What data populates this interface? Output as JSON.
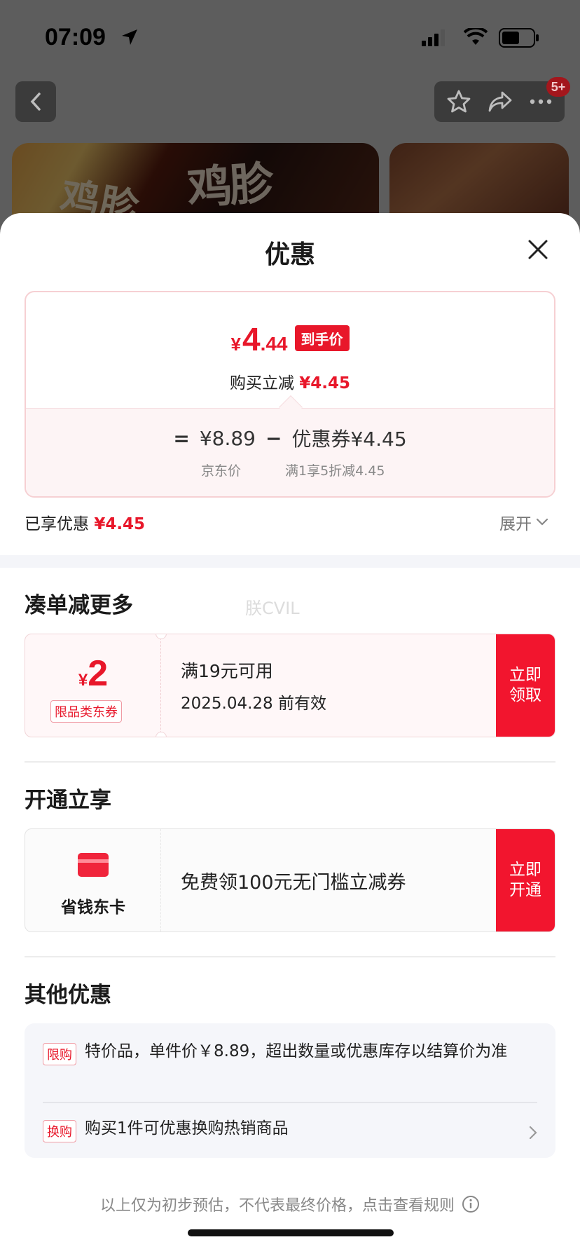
{
  "status_bar": {
    "time": "07:09"
  },
  "top_nav": {
    "badge": "5+"
  },
  "background": {
    "brand_text": "鸡胗"
  },
  "sheet": {
    "title": "优惠",
    "price_card": {
      "currency": "¥",
      "final_int": "4",
      "final_dec": ".44",
      "final_tag": "到手价",
      "instant_off_label": "购买立减",
      "instant_off_value": "¥4.45",
      "formula": {
        "equals": "=",
        "jd_price": "¥8.89",
        "jd_price_label": "京东价",
        "minus": "−",
        "coupon": "优惠券¥4.45",
        "coupon_desc": "满1享5折减4.45"
      }
    },
    "enjoyed": {
      "label": "已享优惠",
      "value": "¥4.45",
      "expand": "展开"
    },
    "watermark": "朕CVIL",
    "more_section": {
      "title": "凑单减更多",
      "coupon": {
        "currency": "¥",
        "amount": "2",
        "category": "限品类东券",
        "condition": "满19元可用",
        "validity": "2025.04.28 前有效",
        "cta_line1": "立即",
        "cta_line2": "领取"
      }
    },
    "membership_section": {
      "title": "开通立享",
      "card_name": "省钱东卡",
      "benefit": "免费领100元无门槛立减券",
      "cta_line1": "立即",
      "cta_line2": "开通"
    },
    "other_section": {
      "title": "其他优惠",
      "offers": [
        {
          "tag": "限购",
          "text": "特价品，单件价￥8.89，超出数量或优惠库存以结算价为准"
        },
        {
          "tag": "换购",
          "text": "购买1件可优惠换购热销商品"
        }
      ]
    },
    "footnote": "以上仅为初步预估，不代表最终价格，点击查看规则"
  },
  "colors": {
    "accent_red": "#e8172a",
    "cta_red": "#f2152e"
  }
}
